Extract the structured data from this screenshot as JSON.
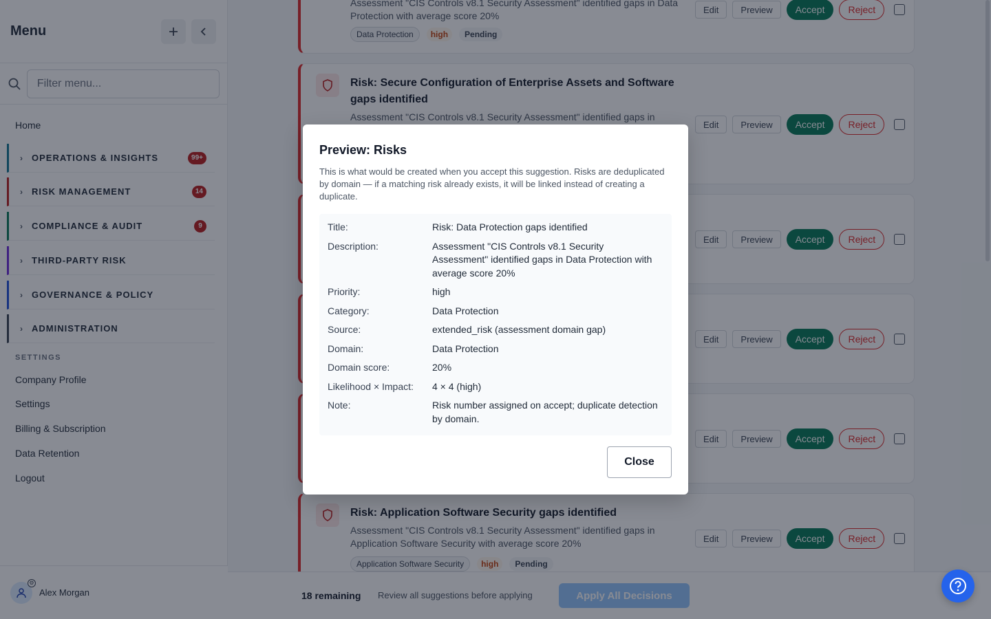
{
  "sidebar": {
    "title": "Menu",
    "add_icon": "plus-icon",
    "collapse_icon": "chevron-left-icon",
    "search_placeholder": "Filter menu...",
    "home": "Home",
    "groups": [
      {
        "label": "OPERATIONS & INSIGHTS",
        "badge": "99+",
        "color": "#0e7490"
      },
      {
        "label": "RISK MANAGEMENT",
        "badge": "14",
        "color": "#b91c1c"
      },
      {
        "label": "COMPLIANCE & AUDIT",
        "badge": "9",
        "color": "#047857"
      },
      {
        "label": "THIRD-PARTY RISK",
        "badge": "",
        "color": "#6d28d9"
      },
      {
        "label": "GOVERNANCE & POLICY",
        "badge": "",
        "color": "#1d4ed8"
      },
      {
        "label": "ADMINISTRATION",
        "badge": "",
        "color": "#374151"
      }
    ],
    "settings_label": "SETTINGS",
    "links": [
      "Company Profile",
      "Settings",
      "Billing & Subscription",
      "Data Retention",
      "Logout"
    ],
    "user_name": "Alex Morgan"
  },
  "cards": [
    {
      "title": "",
      "desc": "Assessment \"CIS Controls v8.1 Security Assessment\" identified gaps in Data Protection with average score 20%",
      "tag": "Data Protection",
      "priority": "high",
      "status": "Pending"
    },
    {
      "title": "Risk: Secure Configuration of Enterprise Assets and Software gaps identified",
      "desc": "Assessment \"CIS Controls v8.1 Security Assessment\" identified gaps in"
    },
    {
      "title": "Risk: Application Software Security gaps identified",
      "desc": "Assessment \"CIS Controls v8.1 Security Assessment\" identified gaps in Application Software Security with average score 20%",
      "tag": "Application Software Security",
      "priority": "high",
      "status": "Pending"
    }
  ],
  "actions": {
    "edit": "Edit",
    "preview": "Preview",
    "accept": "Accept",
    "reject": "Reject"
  },
  "bottom": {
    "remaining": "18 remaining",
    "note": "Review all suggestions before applying",
    "apply": "Apply All Decisions"
  },
  "modal": {
    "title": "Preview: Risks",
    "intro": "This is what would be created when you accept this suggestion. Risks are deduplicated by domain — if a matching risk already exists, it will be linked instead of creating a duplicate.",
    "rows": [
      {
        "k": "Title:",
        "v": "Risk: Data Protection gaps identified"
      },
      {
        "k": "Description:",
        "v": "Assessment \"CIS Controls v8.1 Security Assessment\" identified gaps in Data Protection with average score 20%"
      },
      {
        "k": "Priority:",
        "v": "high"
      },
      {
        "k": "Category:",
        "v": "Data Protection"
      },
      {
        "k": "Source:",
        "v": "extended_risk (assessment domain gap)"
      },
      {
        "k": "Domain:",
        "v": "Data Protection"
      },
      {
        "k": "Domain score:",
        "v": "20%"
      },
      {
        "k": "Likelihood × Impact:",
        "v": "4 × 4 (high)"
      },
      {
        "k": "Note:",
        "v": "Risk number assigned on accept; duplicate detection by domain."
      }
    ],
    "close": "Close"
  }
}
